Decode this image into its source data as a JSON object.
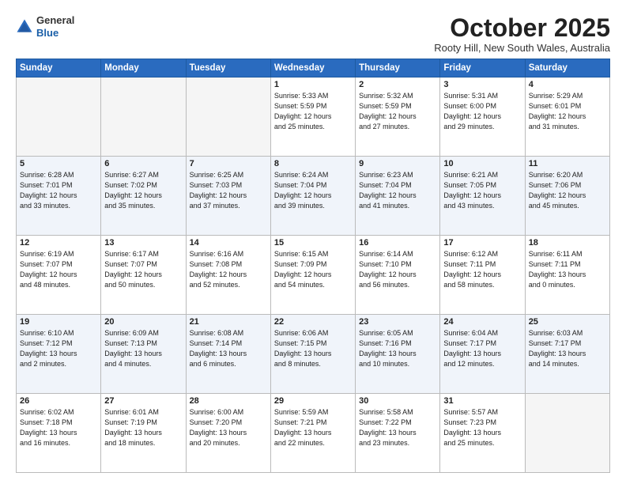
{
  "header": {
    "logo_general": "General",
    "logo_blue": "Blue",
    "month": "October 2025",
    "location": "Rooty Hill, New South Wales, Australia"
  },
  "weekdays": [
    "Sunday",
    "Monday",
    "Tuesday",
    "Wednesday",
    "Thursday",
    "Friday",
    "Saturday"
  ],
  "weeks": [
    [
      {
        "day": "",
        "info": ""
      },
      {
        "day": "",
        "info": ""
      },
      {
        "day": "",
        "info": ""
      },
      {
        "day": "1",
        "info": "Sunrise: 5:33 AM\nSunset: 5:59 PM\nDaylight: 12 hours\nand 25 minutes."
      },
      {
        "day": "2",
        "info": "Sunrise: 5:32 AM\nSunset: 5:59 PM\nDaylight: 12 hours\nand 27 minutes."
      },
      {
        "day": "3",
        "info": "Sunrise: 5:31 AM\nSunset: 6:00 PM\nDaylight: 12 hours\nand 29 minutes."
      },
      {
        "day": "4",
        "info": "Sunrise: 5:29 AM\nSunset: 6:01 PM\nDaylight: 12 hours\nand 31 minutes."
      }
    ],
    [
      {
        "day": "5",
        "info": "Sunrise: 6:28 AM\nSunset: 7:01 PM\nDaylight: 12 hours\nand 33 minutes."
      },
      {
        "day": "6",
        "info": "Sunrise: 6:27 AM\nSunset: 7:02 PM\nDaylight: 12 hours\nand 35 minutes."
      },
      {
        "day": "7",
        "info": "Sunrise: 6:25 AM\nSunset: 7:03 PM\nDaylight: 12 hours\nand 37 minutes."
      },
      {
        "day": "8",
        "info": "Sunrise: 6:24 AM\nSunset: 7:04 PM\nDaylight: 12 hours\nand 39 minutes."
      },
      {
        "day": "9",
        "info": "Sunrise: 6:23 AM\nSunset: 7:04 PM\nDaylight: 12 hours\nand 41 minutes."
      },
      {
        "day": "10",
        "info": "Sunrise: 6:21 AM\nSunset: 7:05 PM\nDaylight: 12 hours\nand 43 minutes."
      },
      {
        "day": "11",
        "info": "Sunrise: 6:20 AM\nSunset: 7:06 PM\nDaylight: 12 hours\nand 45 minutes."
      }
    ],
    [
      {
        "day": "12",
        "info": "Sunrise: 6:19 AM\nSunset: 7:07 PM\nDaylight: 12 hours\nand 48 minutes."
      },
      {
        "day": "13",
        "info": "Sunrise: 6:17 AM\nSunset: 7:07 PM\nDaylight: 12 hours\nand 50 minutes."
      },
      {
        "day": "14",
        "info": "Sunrise: 6:16 AM\nSunset: 7:08 PM\nDaylight: 12 hours\nand 52 minutes."
      },
      {
        "day": "15",
        "info": "Sunrise: 6:15 AM\nSunset: 7:09 PM\nDaylight: 12 hours\nand 54 minutes."
      },
      {
        "day": "16",
        "info": "Sunrise: 6:14 AM\nSunset: 7:10 PM\nDaylight: 12 hours\nand 56 minutes."
      },
      {
        "day": "17",
        "info": "Sunrise: 6:12 AM\nSunset: 7:11 PM\nDaylight: 12 hours\nand 58 minutes."
      },
      {
        "day": "18",
        "info": "Sunrise: 6:11 AM\nSunset: 7:11 PM\nDaylight: 13 hours\nand 0 minutes."
      }
    ],
    [
      {
        "day": "19",
        "info": "Sunrise: 6:10 AM\nSunset: 7:12 PM\nDaylight: 13 hours\nand 2 minutes."
      },
      {
        "day": "20",
        "info": "Sunrise: 6:09 AM\nSunset: 7:13 PM\nDaylight: 13 hours\nand 4 minutes."
      },
      {
        "day": "21",
        "info": "Sunrise: 6:08 AM\nSunset: 7:14 PM\nDaylight: 13 hours\nand 6 minutes."
      },
      {
        "day": "22",
        "info": "Sunrise: 6:06 AM\nSunset: 7:15 PM\nDaylight: 13 hours\nand 8 minutes."
      },
      {
        "day": "23",
        "info": "Sunrise: 6:05 AM\nSunset: 7:16 PM\nDaylight: 13 hours\nand 10 minutes."
      },
      {
        "day": "24",
        "info": "Sunrise: 6:04 AM\nSunset: 7:17 PM\nDaylight: 13 hours\nand 12 minutes."
      },
      {
        "day": "25",
        "info": "Sunrise: 6:03 AM\nSunset: 7:17 PM\nDaylight: 13 hours\nand 14 minutes."
      }
    ],
    [
      {
        "day": "26",
        "info": "Sunrise: 6:02 AM\nSunset: 7:18 PM\nDaylight: 13 hours\nand 16 minutes."
      },
      {
        "day": "27",
        "info": "Sunrise: 6:01 AM\nSunset: 7:19 PM\nDaylight: 13 hours\nand 18 minutes."
      },
      {
        "day": "28",
        "info": "Sunrise: 6:00 AM\nSunset: 7:20 PM\nDaylight: 13 hours\nand 20 minutes."
      },
      {
        "day": "29",
        "info": "Sunrise: 5:59 AM\nSunset: 7:21 PM\nDaylight: 13 hours\nand 22 minutes."
      },
      {
        "day": "30",
        "info": "Sunrise: 5:58 AM\nSunset: 7:22 PM\nDaylight: 13 hours\nand 23 minutes."
      },
      {
        "day": "31",
        "info": "Sunrise: 5:57 AM\nSunset: 7:23 PM\nDaylight: 13 hours\nand 25 minutes."
      },
      {
        "day": "",
        "info": ""
      }
    ]
  ]
}
